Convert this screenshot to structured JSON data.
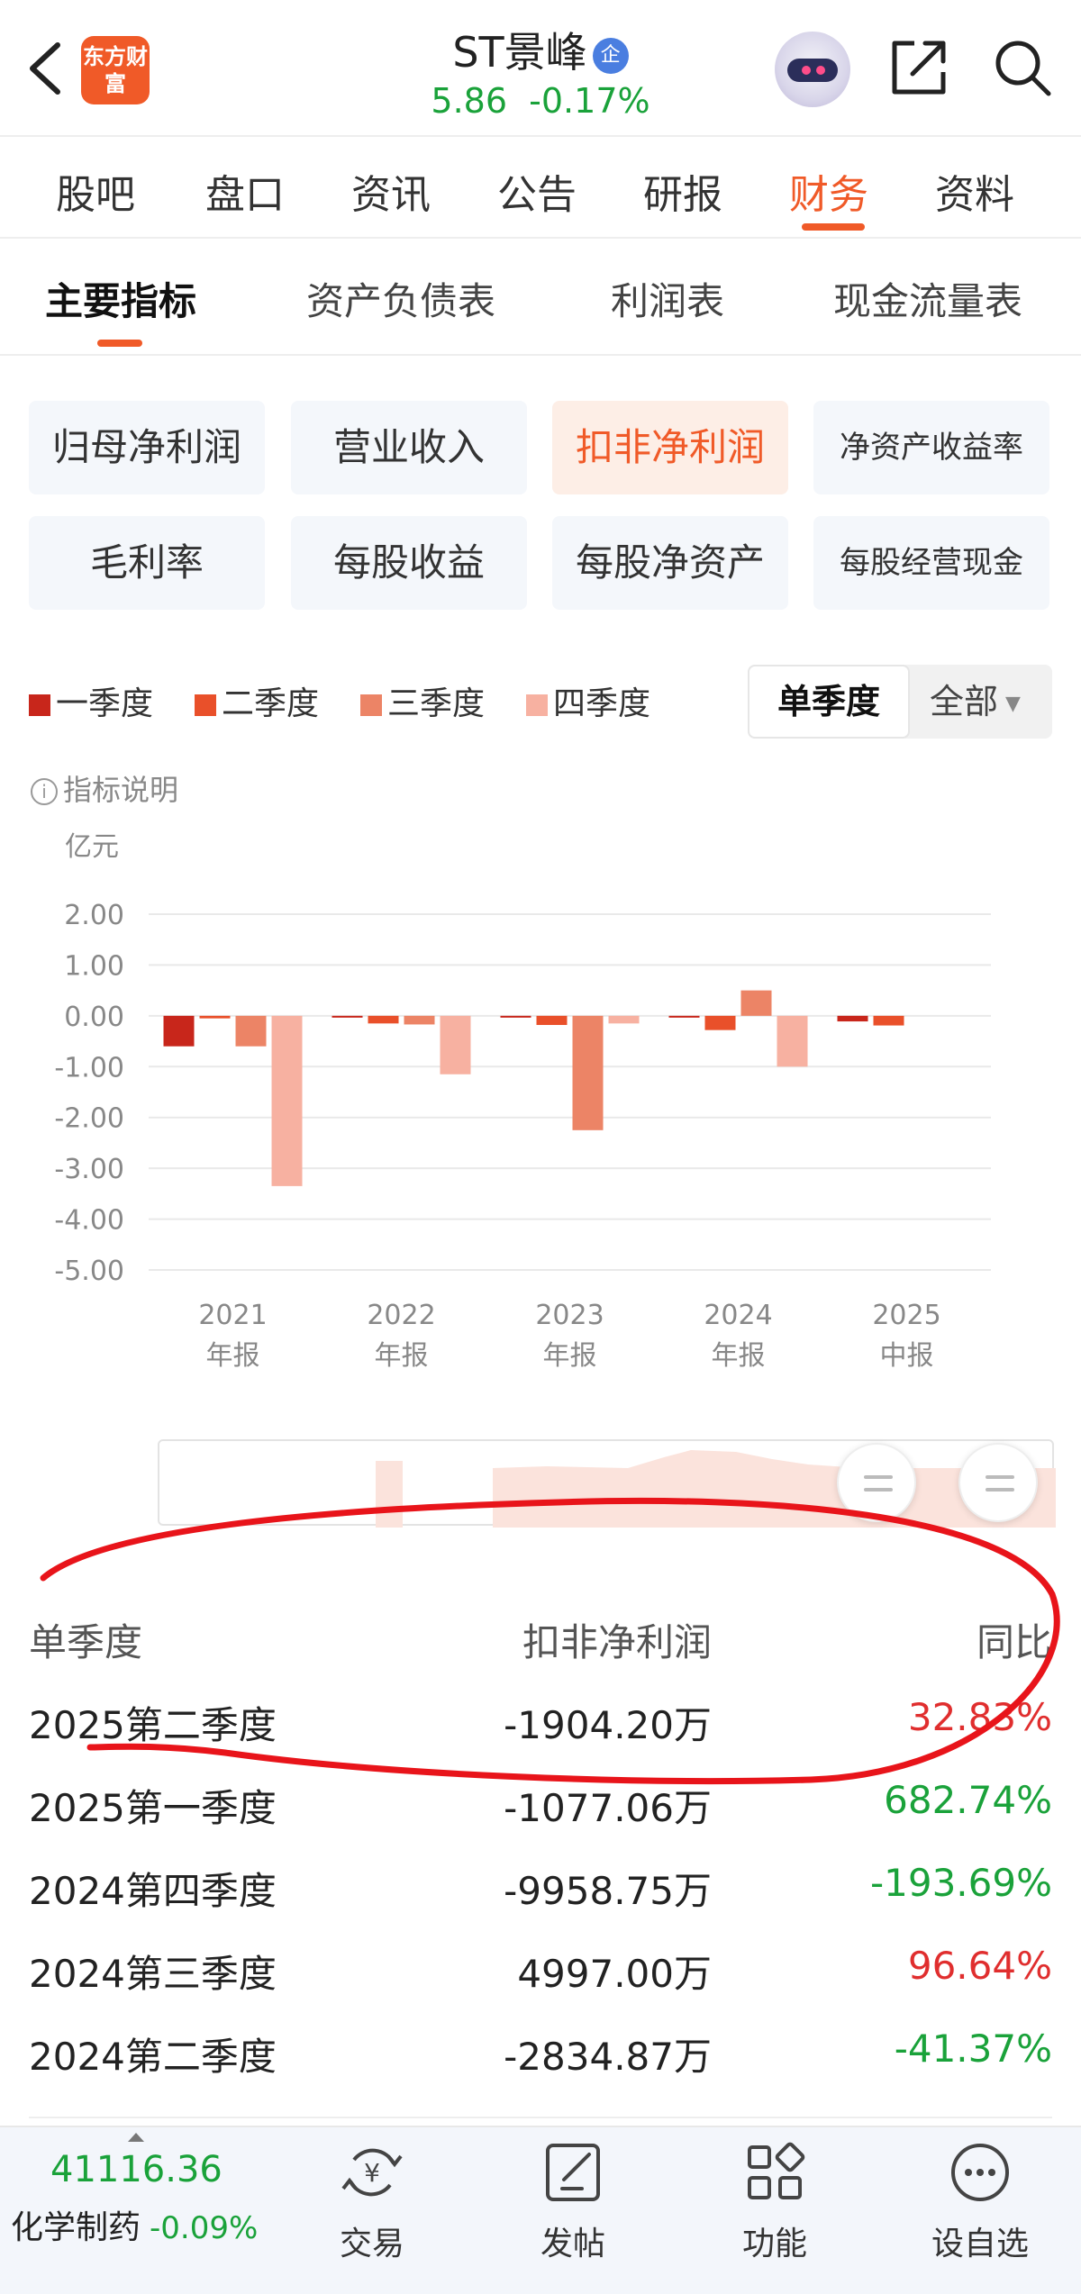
{
  "header": {
    "logo_text": "东方财富",
    "stock_name": "ST景峰",
    "badge": "企",
    "price": "5.86",
    "change_pct": "-0.17%"
  },
  "tabs": [
    "股吧",
    "盘口",
    "资讯",
    "公告",
    "研报",
    "财务",
    "资料"
  ],
  "active_tab": "财务",
  "subtabs": [
    "主要指标",
    "资产负债表",
    "利润表",
    "现金流量表"
  ],
  "active_subtab": "主要指标",
  "metrics": [
    "归母净利润",
    "营业收入",
    "扣非净利润",
    "净资产收益率",
    "毛利率",
    "每股收益",
    "每股净资产",
    "每股经营现金"
  ],
  "active_metric": "扣非净利润",
  "legend": [
    {
      "label": "一季度",
      "color": "#c8261b"
    },
    {
      "label": "二季度",
      "color": "#e9502a"
    },
    {
      "label": "三季度",
      "color": "#ec8466"
    },
    {
      "label": "四季度",
      "color": "#f7b1a1"
    }
  ],
  "toggle": {
    "single": "单季度",
    "all": "全部"
  },
  "indicator_note": "指标说明",
  "chart_data": {
    "type": "bar",
    "unit_label": "亿元",
    "ylim": [
      -5,
      2
    ],
    "y_ticks": [
      "2.00",
      "1.00",
      "0.00",
      "-1.00",
      "-2.00",
      "-3.00",
      "-4.00",
      "-5.00"
    ],
    "categories": [
      "2021 年报",
      "2022 年报",
      "2023 年报",
      "2024 年报",
      "2025 中报"
    ],
    "category_labels": [
      [
        "2021",
        "年报"
      ],
      [
        "2022",
        "年报"
      ],
      [
        "2023",
        "年报"
      ],
      [
        "2024",
        "年报"
      ],
      [
        "2025",
        "中报"
      ]
    ],
    "series": [
      {
        "name": "一季度",
        "values": [
          -0.6,
          -0.02,
          -0.02,
          -0.03,
          -0.11
        ]
      },
      {
        "name": "二季度",
        "values": [
          -0.05,
          -0.15,
          -0.18,
          -0.28,
          -0.19
        ]
      },
      {
        "name": "三季度",
        "values": [
          -0.6,
          -0.17,
          -2.25,
          0.5,
          null
        ]
      },
      {
        "name": "四季度",
        "values": [
          -3.35,
          -1.15,
          -0.15,
          -1.0,
          null
        ]
      }
    ],
    "grid": true
  },
  "table": {
    "headers": [
      "单季度",
      "扣非净利润",
      "同比"
    ],
    "rows": [
      {
        "period": "2025第二季度",
        "value": "-1904.20万",
        "yoy": "32.83%",
        "trend": "pos"
      },
      {
        "period": "2025第一季度",
        "value": "-1077.06万",
        "yoy": "682.74%",
        "trend": "neg"
      },
      {
        "period": "2024第四季度",
        "value": "-9958.75万",
        "yoy": "-193.69%",
        "trend": "neg"
      },
      {
        "period": "2024第三季度",
        "value": "4997.00万",
        "yoy": "96.64%",
        "trend": "pos"
      },
      {
        "period": "2024第二季度",
        "value": "-2834.87万",
        "yoy": "-41.37%",
        "trend": "neg"
      }
    ]
  },
  "bottom_nav": {
    "index_value": "41116.36",
    "index_name": "化学制药",
    "index_change": "-0.09%",
    "items": [
      {
        "label": "交易",
        "icon": "trade-icon"
      },
      {
        "label": "发帖",
        "icon": "post-icon"
      },
      {
        "label": "功能",
        "icon": "grid-icon"
      },
      {
        "label": "设自选",
        "icon": "more-icon"
      }
    ]
  }
}
